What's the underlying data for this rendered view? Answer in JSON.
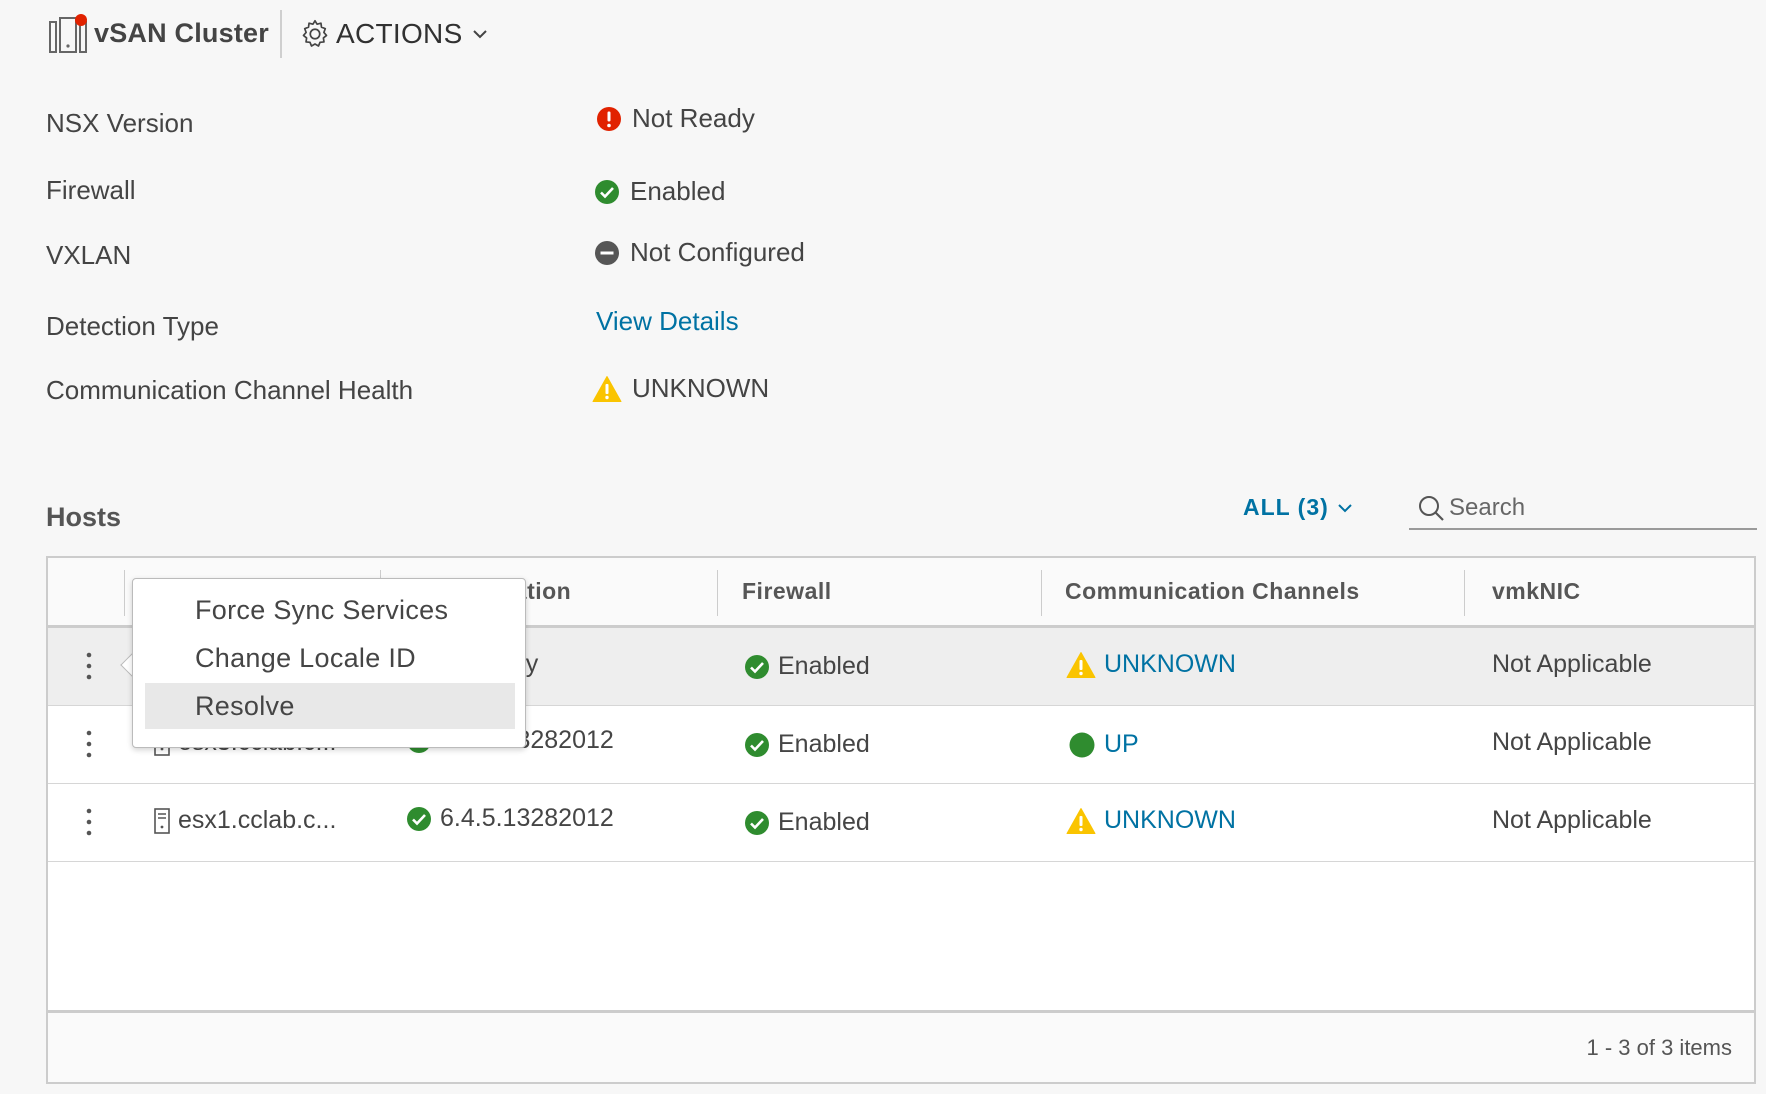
{
  "header": {
    "title": "vSAN Cluster",
    "actions_label": "ACTIONS"
  },
  "properties": [
    {
      "label": "NSX Version",
      "value": "Not Ready",
      "status": "error",
      "is_link": false
    },
    {
      "label": "Firewall",
      "value": "Enabled",
      "status": "ok",
      "is_link": false
    },
    {
      "label": "VXLAN",
      "value": "Not Configured",
      "status": "none",
      "is_link": false
    },
    {
      "label": "Detection Type",
      "value": "View Details",
      "status": "link",
      "is_link": true
    },
    {
      "label": "Communication Channel Health",
      "value": "UNKNOWN",
      "status": "warning",
      "is_link": false
    }
  ],
  "hosts": {
    "title": "Hosts",
    "filter_label": "ALL (3)",
    "search_placeholder": "Search",
    "columns": {
      "installation": "llation",
      "firewall": "Firewall",
      "channels": "Communication Channels",
      "vmknic": "vmkNIC"
    },
    "rows": [
      {
        "host": "",
        "installation": "ady",
        "firewall": "Enabled",
        "channel": "UNKNOWN",
        "vmknic": "Not Applicable"
      },
      {
        "host": "esx3.cclab.c...",
        "installation": "6.4.5.13282012",
        "firewall": "Enabled",
        "channel": "UP",
        "vmknic": "Not Applicable"
      },
      {
        "host": "esx1.cclab.c...",
        "installation": "6.4.5.13282012",
        "firewall": "Enabled",
        "channel": "UNKNOWN",
        "vmknic": "Not Applicable"
      }
    ],
    "footer": "1 - 3 of 3 items"
  },
  "context_menu": {
    "items": [
      "Force Sync Services",
      "Change Locale ID",
      "Resolve"
    ]
  },
  "colors": {
    "link": "#0072a3",
    "ok": "#2f8c2f",
    "error": "#e12200",
    "warning": "#fac400",
    "neutral": "#565656"
  }
}
